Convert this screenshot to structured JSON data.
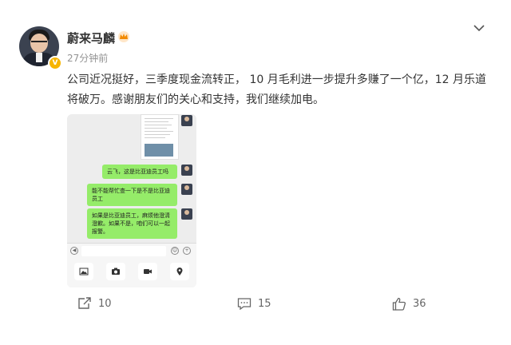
{
  "post": {
    "username": "蔚来马麟",
    "time": "27分钟前",
    "content": "公司近况挺好，三季度现金流转正， 10 月毛利进一步提升多赚了一个亿，12 月乐道将破万。感谢朋友们的关心和支持，我们继续加电。"
  },
  "chat": {
    "messages": [
      "云飞，这是比亚迪员工吗",
      "能不能帮忙查一下是不是比亚迪员工",
      "如果是比亚迪员工，麻烦他澄清澄歉。如果不是，咱们可以一起报警。"
    ]
  },
  "actions": {
    "repost_count": "10",
    "comment_count": "15",
    "like_count": "36"
  },
  "colors": {
    "bubble": "#95ec69",
    "verified_badge": "#f7b500"
  },
  "icons": [
    "v-badge",
    "crown-icon",
    "chevron-down-icon",
    "repost-icon",
    "comment-icon",
    "like-icon",
    "voice-icon",
    "emoji-icon",
    "add-icon",
    "album-icon",
    "camera-icon",
    "video-call-icon",
    "location-icon"
  ]
}
